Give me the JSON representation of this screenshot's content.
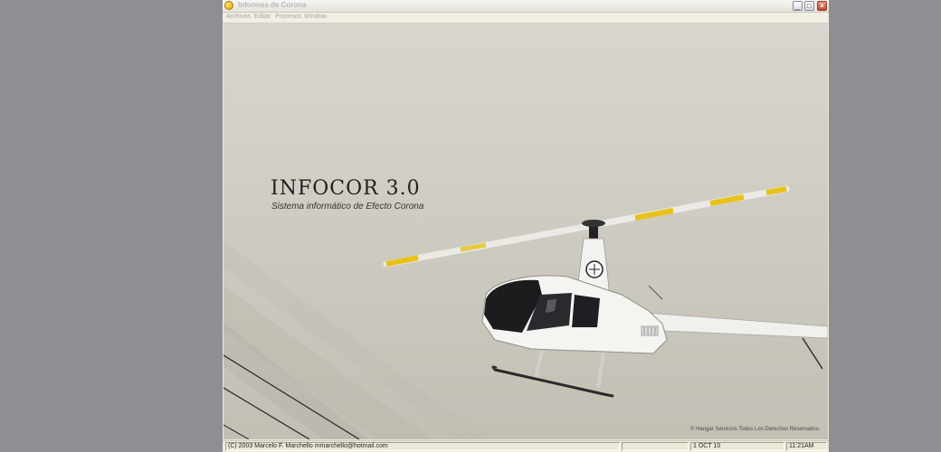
{
  "window": {
    "title": "Informes de Corona",
    "icon": "app-coin-icon"
  },
  "menubar": {
    "items": [
      {
        "label": "Archivos"
      },
      {
        "label": "Editar"
      },
      {
        "label": "Procesos"
      },
      {
        "label": "Window"
      }
    ]
  },
  "splash": {
    "product_name": "INFOCOR 3.0",
    "subtitle": "Sistema informático de Efecto Corona",
    "copyright": "Hangar Servicios Todos Los Derechos Reservados.",
    "image": "helicopter-photo"
  },
  "statusbar": {
    "credit": "(C) 2003 Marcelo F. Marchello mmarchello@hotmail.com",
    "empty_pane": "",
    "date": "1 OCT 10",
    "time": "11:21AM"
  },
  "colors": {
    "desktop": "#8e8e93",
    "rotor_accent": "#e8c21a",
    "window_chrome": "#ece9d8"
  }
}
